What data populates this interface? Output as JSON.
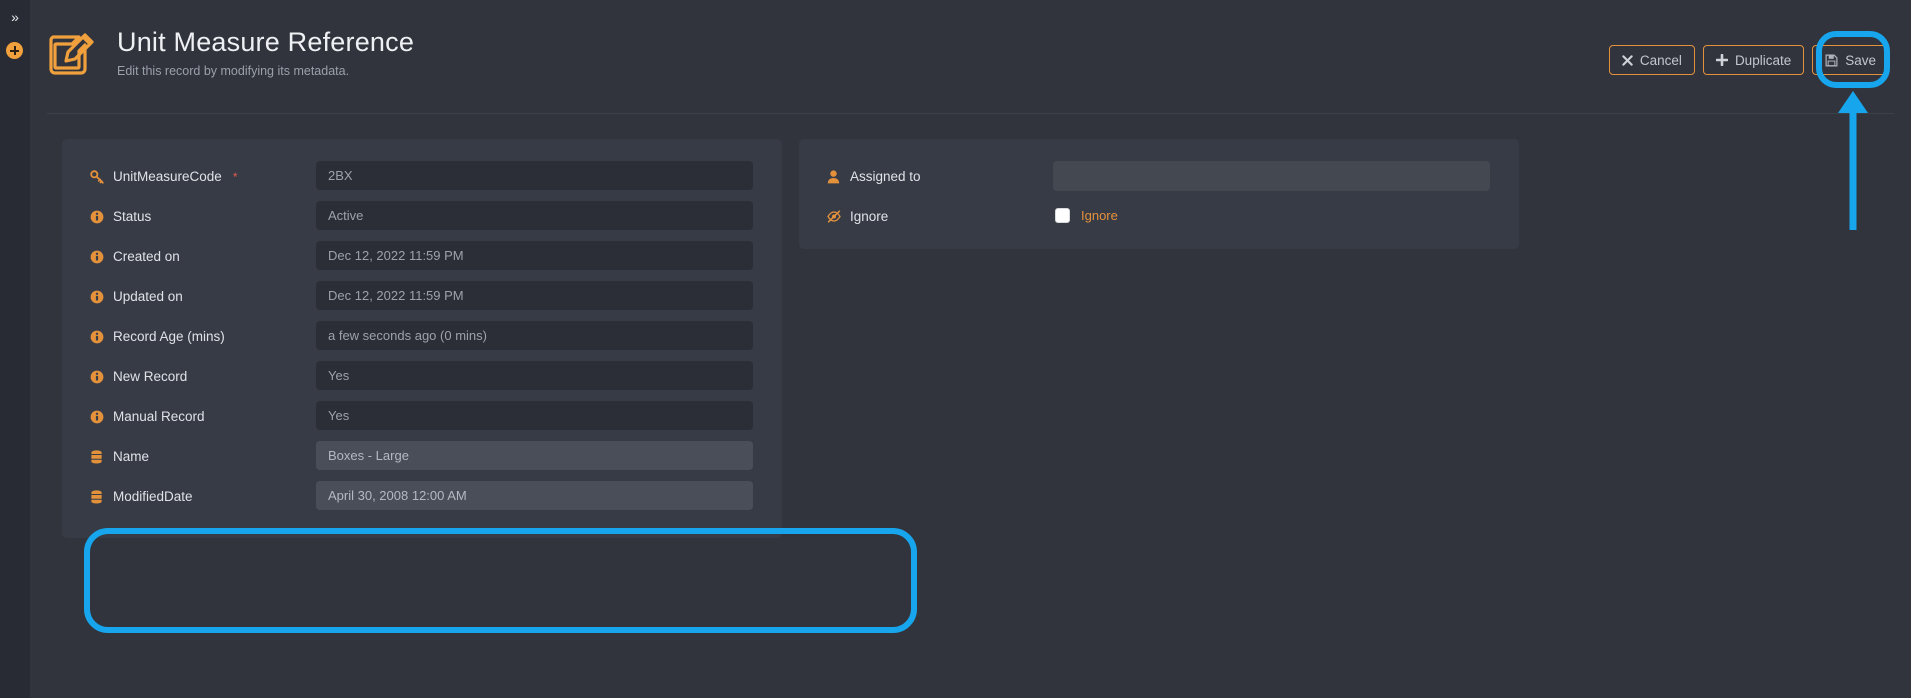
{
  "rail": {
    "toggle_icon": "chevron-double-right-icon",
    "toggle_glyph": "»",
    "badge_icon": "add-circle-icon"
  },
  "header": {
    "icon": "edit-document-icon",
    "title": "Unit Measure Reference",
    "subtitle": "Edit this record by modifying its metadata."
  },
  "actions": [
    {
      "name": "cancel-button",
      "icon": "close-x-icon",
      "label": "Cancel"
    },
    {
      "name": "duplicate-button",
      "icon": "plus-icon",
      "label": "Duplicate"
    },
    {
      "name": "save-button",
      "icon": "floppy-disk-icon",
      "label": "Save"
    }
  ],
  "left_panel": {
    "fields": [
      {
        "label": "UnitMeasureCode",
        "required": true,
        "icon": "key-icon",
        "value": "2BX",
        "highlighted": false,
        "editable": false
      },
      {
        "label": "Status",
        "required": false,
        "icon": "info-icon",
        "value": "Active",
        "highlighted": false,
        "editable": false
      },
      {
        "label": "Created on",
        "required": false,
        "icon": "info-icon",
        "value": "Dec 12, 2022 11:59 PM",
        "highlighted": false,
        "editable": false
      },
      {
        "label": "Updated on",
        "required": false,
        "icon": "info-icon",
        "value": "Dec 12, 2022 11:59 PM",
        "highlighted": false,
        "editable": false
      },
      {
        "label": "Record Age (mins)",
        "required": false,
        "icon": "info-icon",
        "value": "a few seconds ago (0 mins)",
        "highlighted": false,
        "editable": false
      },
      {
        "label": "New Record",
        "required": false,
        "icon": "info-icon",
        "value": "Yes",
        "highlighted": false,
        "editable": false
      },
      {
        "label": "Manual Record",
        "required": false,
        "icon": "info-icon",
        "value": "Yes",
        "highlighted": false,
        "editable": false
      },
      {
        "label": "Name",
        "required": false,
        "icon": "database-icon",
        "value": "Boxes - Large",
        "highlighted": true,
        "editable": false
      },
      {
        "label": "ModifiedDate",
        "required": false,
        "icon": "database-icon",
        "value": "April 30, 2008 12:00 AM",
        "highlighted": true,
        "editable": false
      }
    ]
  },
  "right_panel": {
    "assigned_to": {
      "label": "Assigned to",
      "icon": "user-icon",
      "value": ""
    },
    "ignore": {
      "label": "Ignore",
      "icon": "eye-slash-icon",
      "checkbox_label": "Ignore",
      "checked": false
    }
  },
  "annotations": {
    "highlight_color": "#17a6ed",
    "save_ring": "save-button-highlight",
    "fields_ring": "name-modifieddate-highlight",
    "arrow": "arrow-pointing-to-save-button"
  },
  "colors": {
    "accent": "#e4913c",
    "background": "#31343d",
    "rail": "#282b33",
    "panel": "#373b45",
    "input": "#2b2e36",
    "input_highlight": "#4a4e58",
    "input_editable": "#434851",
    "required_asterisk": "#e05c4b",
    "highlight": "#17a6ed"
  }
}
